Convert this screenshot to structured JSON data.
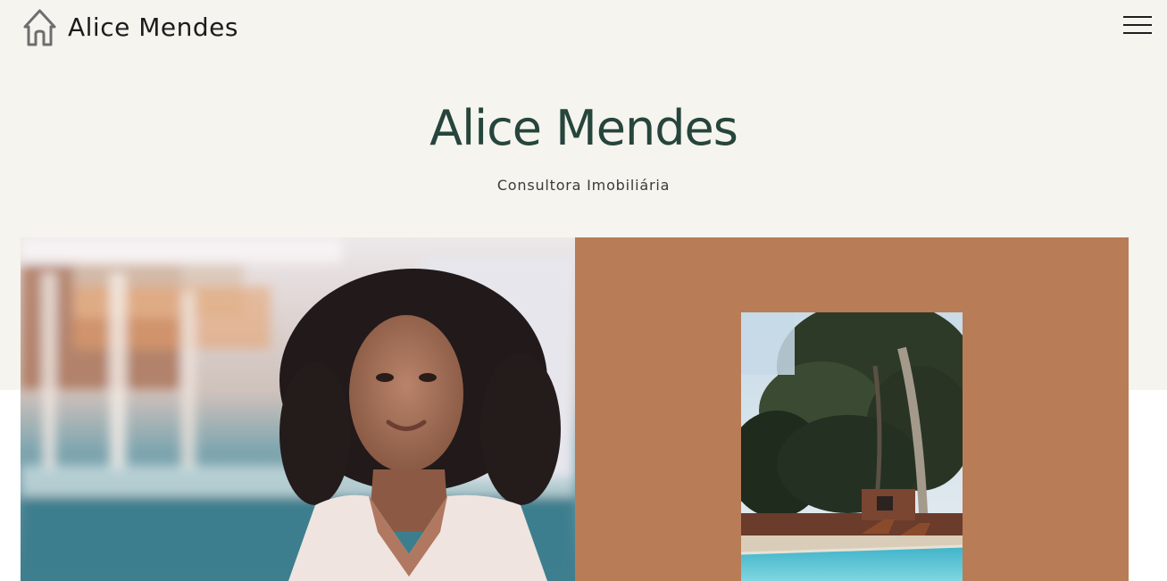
{
  "header": {
    "brand_name": "Alice Mendes",
    "logo_icon": "house-outline-icon",
    "menu_icon": "hamburger-menu-icon"
  },
  "hero": {
    "title": "Alice Mendes",
    "subtitle": "Consultora Imobiliária"
  },
  "colors": {
    "hero_background": "#f5f4ee",
    "title": "#26453c",
    "accent_panel": "#b87c57"
  }
}
